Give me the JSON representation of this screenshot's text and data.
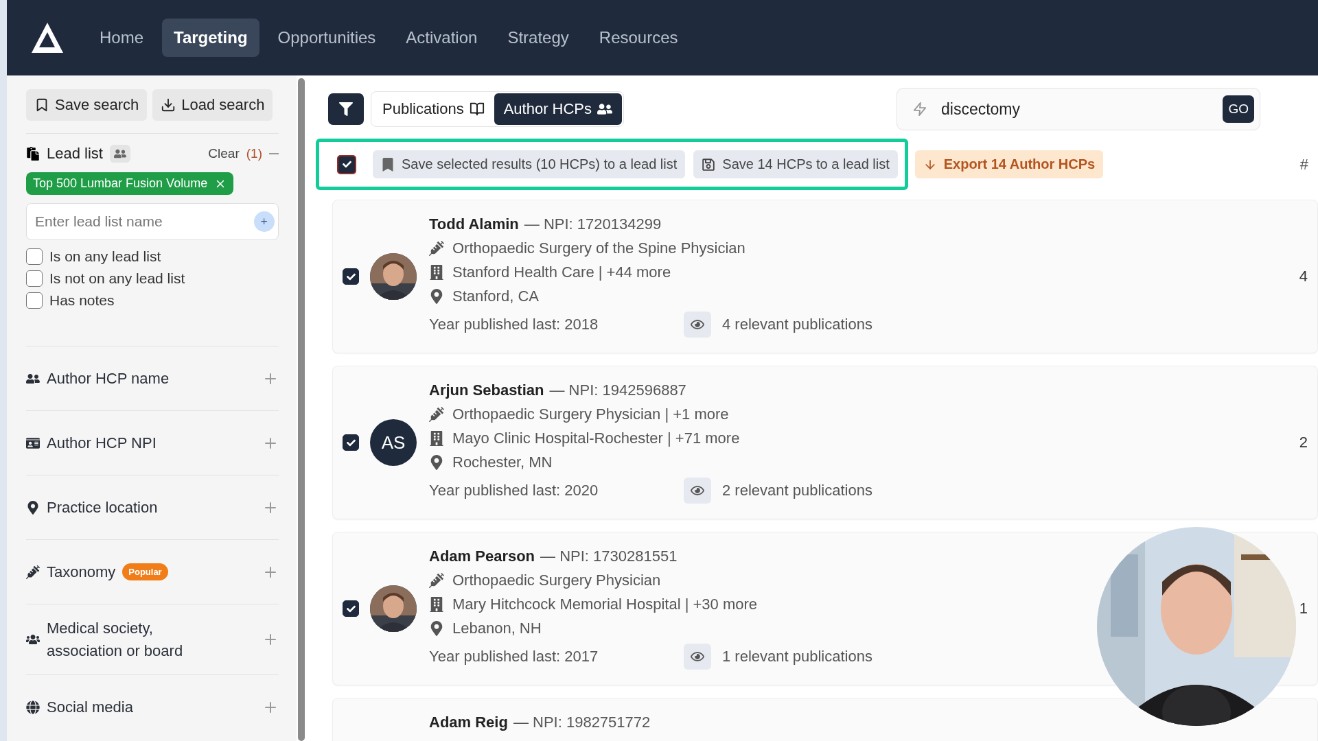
{
  "nav": {
    "items": [
      {
        "label": "Home",
        "selected": false
      },
      {
        "label": "Targeting",
        "selected": true
      },
      {
        "label": "Opportunities",
        "selected": false
      },
      {
        "label": "Activation",
        "selected": false
      },
      {
        "label": "Strategy",
        "selected": false
      },
      {
        "label": "Resources",
        "selected": false
      }
    ]
  },
  "sidebar": {
    "buttons": [
      "Save search",
      "Load search"
    ],
    "lead_list": {
      "title": "Lead list",
      "clear": "Clear",
      "clear_count": "(1)",
      "tag": "Top 500 Lumbar Fusion Volume",
      "placeholder": "Enter lead list name",
      "checkboxes": [
        {
          "label": "Is on any lead list",
          "checked": false
        },
        {
          "label": "Is not on any lead list",
          "checked": false
        },
        {
          "label": "Has notes",
          "checked": false
        }
      ]
    },
    "filters": [
      {
        "label": "Author HCP name"
      },
      {
        "label": "Author HCP NPI"
      },
      {
        "label": "Practice location"
      },
      {
        "label": "Taxonomy",
        "badge": "Popular"
      },
      {
        "label": "Medical society, association or board"
      },
      {
        "label": "Social media"
      }
    ]
  },
  "toolbar": {
    "tabs": [
      {
        "label": "Publications",
        "selected": false
      },
      {
        "label": "Author HCPs",
        "selected": true
      }
    ],
    "search": {
      "value": "discectomy",
      "go": "GO"
    },
    "select_all": {
      "checked": true
    },
    "save_selected": "Save selected results (10 HCPs) to a lead list",
    "save_all": "Save 14 HCPs to a lead list",
    "export": "Export 14 Author HCPs",
    "column_header": "#"
  },
  "results": [
    {
      "name": "Todd Alamin",
      "npi": "— NPI: 1720134299",
      "taxonomy": "Orthopaedic Surgery of the Spine Physician",
      "organization": "Stanford Health Care | +44 more",
      "location": "Stanford, CA",
      "year": "Year published last: 2018",
      "publications": "4 relevant publications",
      "count": "4",
      "checked": true
    },
    {
      "name": "Arjun Sebastian",
      "npi": "— NPI: 1942596887",
      "taxonomy": "Orthopaedic Surgery Physician | +1 more",
      "organization": "Mayo Clinic Hospital-Rochester | +71 more",
      "location": "Rochester, MN",
      "year": "Year published last: 2020",
      "publications": "2 relevant publications",
      "count": "2",
      "checked": true,
      "avatar": {
        "kind": "initials",
        "text": "AS"
      }
    },
    {
      "name": "Adam Pearson",
      "npi": "— NPI: 1730281551",
      "taxonomy": "Orthopaedic Surgery Physician",
      "organization": "Mary Hitchcock Memorial Hospital | +30 more",
      "location": "Lebanon, NH",
      "year": "Year published last: 2017",
      "publications": "1 relevant publications",
      "count": "1",
      "checked": true
    },
    {
      "name": "Adam Reig",
      "npi": "— NPI: 1982751772"
    }
  ]
}
